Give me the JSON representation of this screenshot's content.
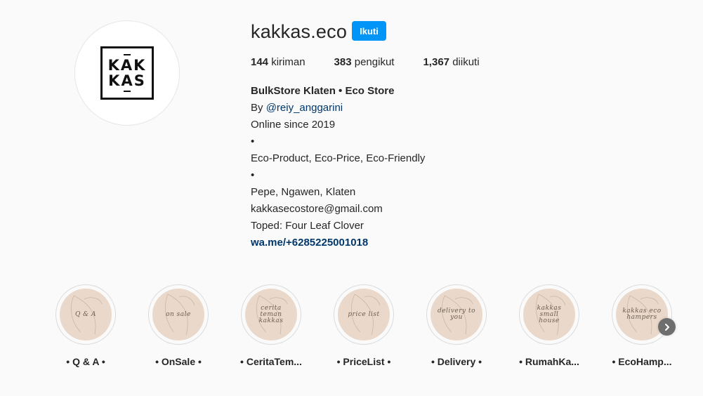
{
  "profile": {
    "username": "kakkas.eco",
    "follow_label": "Ikuti",
    "logo": {
      "line1": "KAK",
      "line2": "KAS"
    },
    "stats": {
      "posts_count": "144",
      "posts_label": "kiriman",
      "followers_count": "383",
      "followers_label": "pengikut",
      "following_count": "1,367",
      "following_label": "diikuti"
    }
  },
  "bio": {
    "name": "BulkStore Klaten • Eco Store",
    "by_prefix": "By ",
    "mention": "@reiy_anggarini",
    "line_online": "Online since 2019",
    "bullet1": "•",
    "line_eco": "Eco-Product, Eco-Price, Eco-Friendly",
    "bullet2": "•",
    "line_location": "Pepe, Ngawen, Klaten",
    "line_email": "kakkasecostore@gmail.com",
    "line_toped": "Toped: Four Leaf Clover",
    "link": "wa.me/+6285225001018"
  },
  "highlights": [
    {
      "label": "• Q & A •",
      "cover_text": "Q & A"
    },
    {
      "label": "• OnSale •",
      "cover_text": "on sale"
    },
    {
      "label": "• CeritaTem...",
      "cover_text": "cerita teman kakkas"
    },
    {
      "label": "• PriceList •",
      "cover_text": "price list"
    },
    {
      "label": "• Delivery •",
      "cover_text": "delivery to you"
    },
    {
      "label": "• RumahKa...",
      "cover_text": "kakkas small house"
    },
    {
      "label": "• EcoHamp...",
      "cover_text": "kakkas eco hampers"
    }
  ],
  "icons": {
    "next": "chevron-right-icon"
  },
  "colors": {
    "background": "#fafafa",
    "follow_button": "#0095f6",
    "link": "#00376b",
    "highlight_cover": "#ead9ca"
  }
}
